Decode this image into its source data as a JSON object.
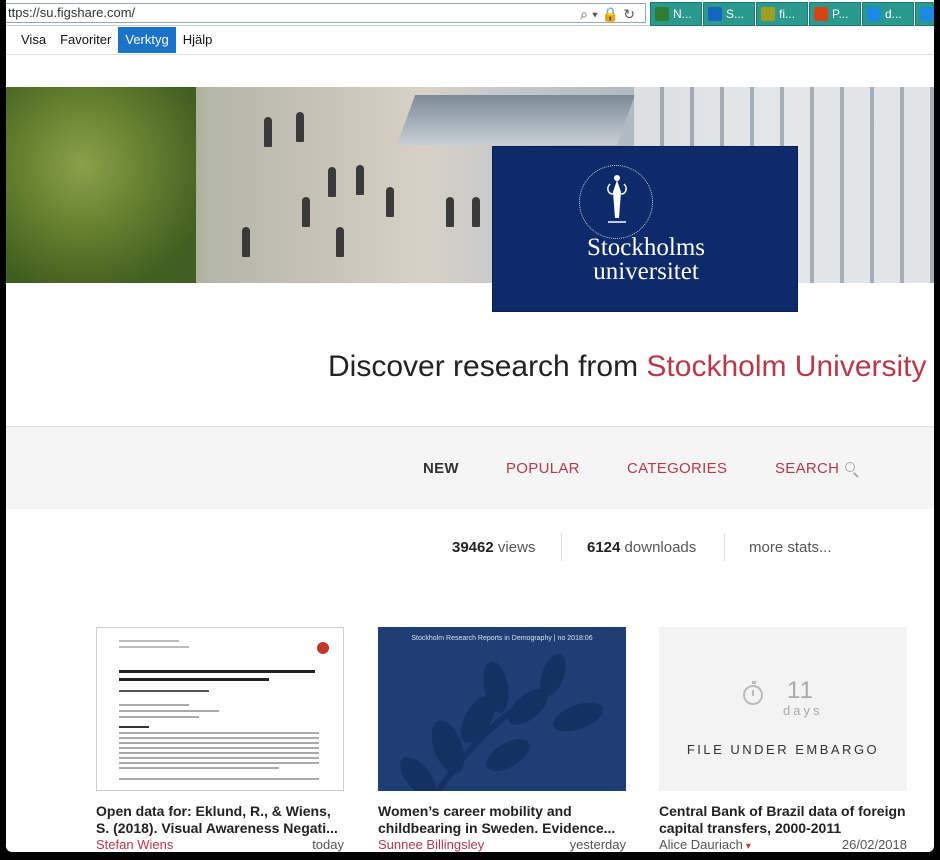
{
  "browser": {
    "url": "ttps://su.figshare.com/",
    "tabs": [
      {
        "label": "N...",
        "color": "#2e7d32"
      },
      {
        "label": "S...",
        "color": "#1565c0"
      },
      {
        "label": "fi...",
        "color": "#9e9d24"
      },
      {
        "label": "P...",
        "color": "#d84315"
      },
      {
        "label": "d...",
        "color": "#1e88e5"
      },
      {
        "label": "",
        "color": "#1e88e5"
      }
    ]
  },
  "menu": {
    "items": [
      "Visa",
      "Favoriter",
      "Verktyg",
      "Hjälp"
    ],
    "active": "Verktyg"
  },
  "logo": {
    "line1": "Stockholms",
    "line2": "universitet"
  },
  "headline": {
    "prefix": "Discover research from ",
    "accent": "Stockholm University"
  },
  "nav": {
    "new": "NEW",
    "popular": "POPULAR",
    "categories": "CATEGORIES",
    "search": "SEARCH"
  },
  "stats": {
    "views_count": "39462",
    "views_label": "views",
    "downloads_count": "6124",
    "downloads_label": "downloads",
    "more": "more stats..."
  },
  "cards": [
    {
      "title": "Open data for: Eklund, R., & Wiens, S. (2018). Visual Awareness Negati...",
      "author": "Stefan Wiens",
      "date": "today"
    },
    {
      "report_header": "Stockholm Research Reports in Demography | no 2018:06",
      "title": "Women’s career mobility and childbearing in Sweden. Evidence...",
      "author": "Sunnee Billingsley",
      "date": "yesterday"
    },
    {
      "embargo_days": "11",
      "embargo_days_label": "days",
      "embargo_text": "FILE UNDER EMBARGO",
      "title": "Central Bank of Brazil data of foreign capital transfers, 2000-2011",
      "author": "Alice Dauriach",
      "date": "26/02/2018"
    }
  ],
  "colors": {
    "accent": "#b63a4a",
    "logo_blue": "#0d2a6a",
    "menu_active": "#1a73c9"
  }
}
